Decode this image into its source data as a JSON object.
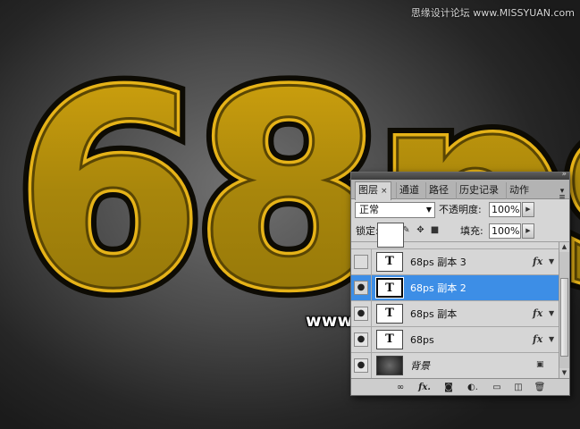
{
  "watermark": "思缘设计论坛 www.MISSYUAN.com",
  "artwork_text": "68ps",
  "site_mark": "www.68ps.com",
  "colors": {
    "gold": "#b8920a",
    "gold_light": "#f0c020",
    "selection": "#3d8ee6"
  },
  "panel": {
    "tabs": [
      {
        "label": "图层",
        "close": "×"
      },
      {
        "label": "通道"
      },
      {
        "label": "路径"
      },
      {
        "label": "历史记录"
      },
      {
        "label": "动作"
      }
    ],
    "blend_mode": "正常",
    "opacity_label": "不透明度:",
    "opacity_value": "100%",
    "lock_label": "锁定:",
    "fill_label": "填充:",
    "fill_value": "100%",
    "layers": [
      {
        "name": "68ps  副本 3",
        "thumb": "T",
        "visible": false,
        "fx": "fx",
        "selected": false
      },
      {
        "name": "68ps  副本 2",
        "thumb": "T",
        "visible": true,
        "fx": "",
        "selected": true
      },
      {
        "name": "68ps  副本",
        "thumb": "T",
        "visible": true,
        "fx": "fx",
        "selected": false
      },
      {
        "name": "68ps",
        "thumb": "T",
        "visible": true,
        "fx": "fx",
        "selected": false
      },
      {
        "name": "背景",
        "thumb": "",
        "visible": true,
        "fx": "",
        "locked": true,
        "selected": false
      }
    ],
    "bottom_icons": [
      "link-layers-icon",
      "fx-icon",
      "mask-icon",
      "adjustment-icon",
      "folder-icon",
      "new-layer-icon",
      "trash-icon"
    ],
    "bottom_fx": "fx."
  }
}
